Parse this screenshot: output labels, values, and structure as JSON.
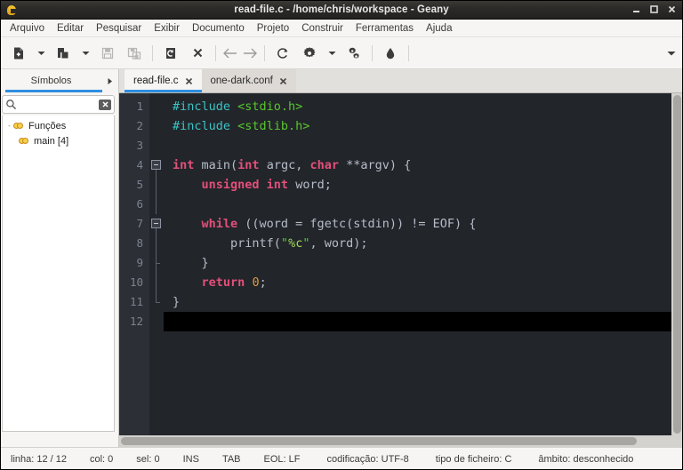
{
  "window": {
    "title": "read-file.c - /home/chris/workspace - Geany",
    "icon": "geany-icon",
    "buttons": {
      "minimize": "minimize-icon",
      "maximize": "maximize-icon",
      "close": "close-icon"
    }
  },
  "menubar": {
    "items": [
      {
        "label": "Arquivo"
      },
      {
        "label": "Editar"
      },
      {
        "label": "Pesquisar"
      },
      {
        "label": "Exibir"
      },
      {
        "label": "Documento"
      },
      {
        "label": "Projeto"
      },
      {
        "label": "Construir"
      },
      {
        "label": "Ferramentas"
      },
      {
        "label": "Ajuda"
      }
    ]
  },
  "toolbar": {
    "items": [
      {
        "name": "new-file-button",
        "icon": "new-file-icon",
        "enabled": true
      },
      {
        "name": "new-file-menu-button",
        "icon": "chevron-down-icon",
        "enabled": true
      },
      {
        "name": "open-file-button",
        "icon": "open-folder-icon",
        "enabled": true
      },
      {
        "name": "open-recent-menu-button",
        "icon": "chevron-down-icon",
        "enabled": true
      },
      {
        "name": "save-button",
        "icon": "save-icon",
        "enabled": false
      },
      {
        "name": "save-all-button",
        "icon": "save-all-icon",
        "enabled": false
      },
      {
        "name": "revert-button",
        "icon": "revert-icon",
        "enabled": true
      },
      {
        "name": "close-file-button",
        "icon": "close-x-icon",
        "enabled": true
      },
      {
        "name": "back-button",
        "icon": "arrow-left-icon",
        "enabled": false
      },
      {
        "name": "forward-button",
        "icon": "arrow-right-icon",
        "enabled": false
      },
      {
        "name": "compile-button",
        "icon": "compile-refresh-icon",
        "enabled": true
      },
      {
        "name": "build-button",
        "icon": "gear-icon",
        "enabled": true
      },
      {
        "name": "build-menu-button",
        "icon": "chevron-down-icon",
        "enabled": true
      },
      {
        "name": "run-button",
        "icon": "gear-run-icon",
        "enabled": true
      },
      {
        "name": "color-chooser-button",
        "icon": "color-drop-icon",
        "enabled": true
      }
    ],
    "overflow_icon": "chevron-down-icon"
  },
  "sidebar": {
    "tab_label": "Símbolos",
    "more_icon": "chevron-right-icon",
    "search": {
      "value": "",
      "placeholder": "",
      "icon": "search-icon",
      "clear_icon": "clear-icon"
    },
    "tree": [
      {
        "label": "Funções",
        "level": 0,
        "icon": "symbol-link-icon",
        "expander": "-"
      },
      {
        "label": "main [4]",
        "level": 1,
        "icon": "symbol-link-icon",
        "expander": ""
      }
    ]
  },
  "editor": {
    "tabs": [
      {
        "label": "read-file.c",
        "active": true,
        "close_icon": "close-x-icon"
      },
      {
        "label": "one-dark.conf",
        "active": false,
        "close_icon": "close-x-icon"
      }
    ],
    "current_line": 12,
    "lines": [
      {
        "n": "1",
        "tokens": [
          {
            "t": "#include ",
            "c": "pp"
          },
          {
            "t": "<stdio.h>",
            "c": "hd"
          }
        ]
      },
      {
        "n": "2",
        "tokens": [
          {
            "t": "#include ",
            "c": "pp"
          },
          {
            "t": "<stdlib.h>",
            "c": "hd"
          }
        ]
      },
      {
        "n": "3",
        "tokens": []
      },
      {
        "n": "4",
        "tokens": [
          {
            "t": "int",
            "c": "k"
          },
          {
            "t": " main(",
            "c": "pl"
          },
          {
            "t": "int",
            "c": "k"
          },
          {
            "t": " argc, ",
            "c": "pl"
          },
          {
            "t": "char",
            "c": "k"
          },
          {
            "t": " **argv) {",
            "c": "pl"
          }
        ]
      },
      {
        "n": "5",
        "tokens": [
          {
            "t": "    ",
            "c": "pl"
          },
          {
            "t": "unsigned int",
            "c": "k"
          },
          {
            "t": " word;",
            "c": "pl"
          }
        ]
      },
      {
        "n": "6",
        "tokens": []
      },
      {
        "n": "7",
        "tokens": [
          {
            "t": "    ",
            "c": "pl"
          },
          {
            "t": "while",
            "c": "k"
          },
          {
            "t": " ((word = fgetc(stdin)) != EOF) {",
            "c": "pl"
          }
        ]
      },
      {
        "n": "8",
        "tokens": [
          {
            "t": "        printf(",
            "c": "pl"
          },
          {
            "t": "\"",
            "c": "st"
          },
          {
            "t": "%c",
            "c": "fm"
          },
          {
            "t": "\"",
            "c": "st"
          },
          {
            "t": ", word);",
            "c": "pl"
          }
        ]
      },
      {
        "n": "9",
        "tokens": [
          {
            "t": "    }",
            "c": "pl"
          }
        ]
      },
      {
        "n": "10",
        "tokens": [
          {
            "t": "    ",
            "c": "pl"
          },
          {
            "t": "return",
            "c": "k"
          },
          {
            "t": " ",
            "c": "pl"
          },
          {
            "t": "0",
            "c": "nu"
          },
          {
            "t": ";",
            "c": "pl"
          }
        ]
      },
      {
        "n": "11",
        "tokens": [
          {
            "t": "}",
            "c": "pl"
          }
        ]
      },
      {
        "n": "12",
        "tokens": []
      }
    ]
  },
  "statusbar": {
    "line": "linha: 12 / 12",
    "col": "col: 0",
    "sel": "sel: 0",
    "mode": "INS",
    "indent": "TAB",
    "eol": "EOL: LF",
    "encoding": "codificação: UTF-8",
    "filetype": "tipo de ficheiro: C",
    "scope": "âmbito: desconhecido"
  },
  "colors": {
    "accent": "#2f8fe0",
    "editor_bg": "#22252a",
    "gutter_bg": "#2c2f35",
    "keyword": "#e2507a",
    "preprocessor": "#3cc3c3",
    "string": "#4ec930",
    "number": "#e09b3a"
  }
}
